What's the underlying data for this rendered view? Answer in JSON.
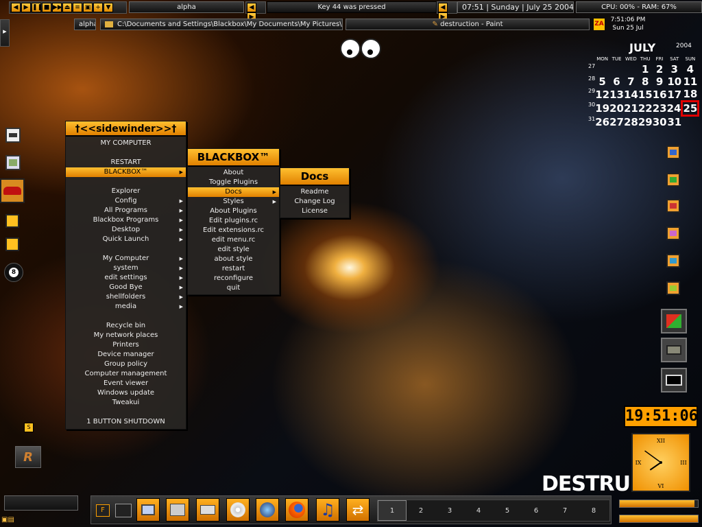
{
  "toolbar": {
    "buttons": [
      "◀",
      "▶",
      "❚❚",
      "■",
      "▶▶",
      "⏏",
      "≡",
      "▣",
      "+",
      "▼"
    ],
    "label": "alpha",
    "message": "Key 44 was pressed",
    "clock": "07:51 | Sunday | July 25 2004",
    "sysmon": "CPU: 00% - RAM: 67%"
  },
  "taskbar_top": {
    "workspace": "alpha",
    "path": "C:\\Documents and Settings\\Blackbox\\My Documents\\My Pictures\\upload",
    "window": "destruction - Paint",
    "za": "ZA",
    "time": "7:51:06 PM",
    "date": "Sun 25 Jul"
  },
  "calendar": {
    "month": "JULY",
    "year": "2004",
    "days": [
      "MON",
      "TUE",
      "WED",
      "THU",
      "FRI",
      "SAT",
      "SUN"
    ],
    "weeks": [
      {
        "wk": "27",
        "d": [
          "",
          "",
          "",
          "1",
          "2",
          "3",
          "4"
        ]
      },
      {
        "wk": "28",
        "d": [
          "5",
          "6",
          "7",
          "8",
          "9",
          "10",
          "11"
        ]
      },
      {
        "wk": "29",
        "d": [
          "12",
          "13",
          "14",
          "15",
          "16",
          "17",
          "18"
        ]
      },
      {
        "wk": "30",
        "d": [
          "19",
          "20",
          "21",
          "22",
          "23",
          "24",
          "25"
        ]
      },
      {
        "wk": "31",
        "d": [
          "26",
          "27",
          "28",
          "29",
          "30",
          "31",
          ""
        ]
      }
    ],
    "today": "25"
  },
  "main_menu": {
    "title": "†<<sidewinder>>†",
    "items": [
      {
        "label": "MY COMPUTER"
      },
      {
        "label": ""
      },
      {
        "label": "RESTART"
      },
      {
        "label": "BLACKBOX™",
        "sub": true,
        "sel": true
      },
      {
        "label": ""
      },
      {
        "label": "Explorer"
      },
      {
        "label": "Config",
        "sub": true
      },
      {
        "label": "All Programs",
        "sub": true
      },
      {
        "label": "Blackbox Programs",
        "sub": true
      },
      {
        "label": "Desktop",
        "sub": true
      },
      {
        "label": "Quick Launch",
        "sub": true
      },
      {
        "label": ""
      },
      {
        "label": "My Computer",
        "sub": true
      },
      {
        "label": "system",
        "sub": true
      },
      {
        "label": "edit settings",
        "sub": true
      },
      {
        "label": "Good Bye",
        "sub": true
      },
      {
        "label": "shellfolders",
        "sub": true
      },
      {
        "label": "media",
        "sub": true
      },
      {
        "label": ""
      },
      {
        "label": "Recycle bin"
      },
      {
        "label": "My network places"
      },
      {
        "label": "Printers"
      },
      {
        "label": "Device manager"
      },
      {
        "label": "Group policy"
      },
      {
        "label": "Computer management"
      },
      {
        "label": "Event viewer"
      },
      {
        "label": "Windows update"
      },
      {
        "label": "Tweakui"
      },
      {
        "label": ""
      },
      {
        "label": "1 BUTTON SHUTDOWN"
      }
    ]
  },
  "bb_menu": {
    "title": "BLACKBOX™",
    "items": [
      {
        "label": "About"
      },
      {
        "label": "Toggle Plugins"
      },
      {
        "label": "Docs",
        "sub": true,
        "sel": true
      },
      {
        "label": "Styles",
        "sub": true
      },
      {
        "label": "About Plugins"
      },
      {
        "label": "Edit plugins.rc"
      },
      {
        "label": "Edit extensions.rc"
      },
      {
        "label": "edit menu.rc"
      },
      {
        "label": "edit style"
      },
      {
        "label": "about style"
      },
      {
        "label": "restart"
      },
      {
        "label": "reconfigure"
      },
      {
        "label": "quit"
      }
    ]
  },
  "docs_menu": {
    "title": "Docs",
    "items": [
      {
        "label": "Readme"
      },
      {
        "label": "Change Log"
      },
      {
        "label": "License"
      }
    ]
  },
  "digital_clock": "19:51:06",
  "analog_clock": {
    "hour": 7,
    "minute": 51,
    "numerals": [
      "XII",
      "III",
      "VI",
      "IX"
    ]
  },
  "branding": "DESTRUC",
  "left_icons": {
    "s_label": "S",
    "eight": "8",
    "r_label": "R"
  },
  "bottom": {
    "f_label": "F",
    "workspaces": [
      "1",
      "2",
      "3",
      "4",
      "5",
      "6",
      "7",
      "8"
    ],
    "active_ws": "1"
  },
  "colors": {
    "accent": "#ffa000",
    "accent_light": "#ffcc40"
  }
}
